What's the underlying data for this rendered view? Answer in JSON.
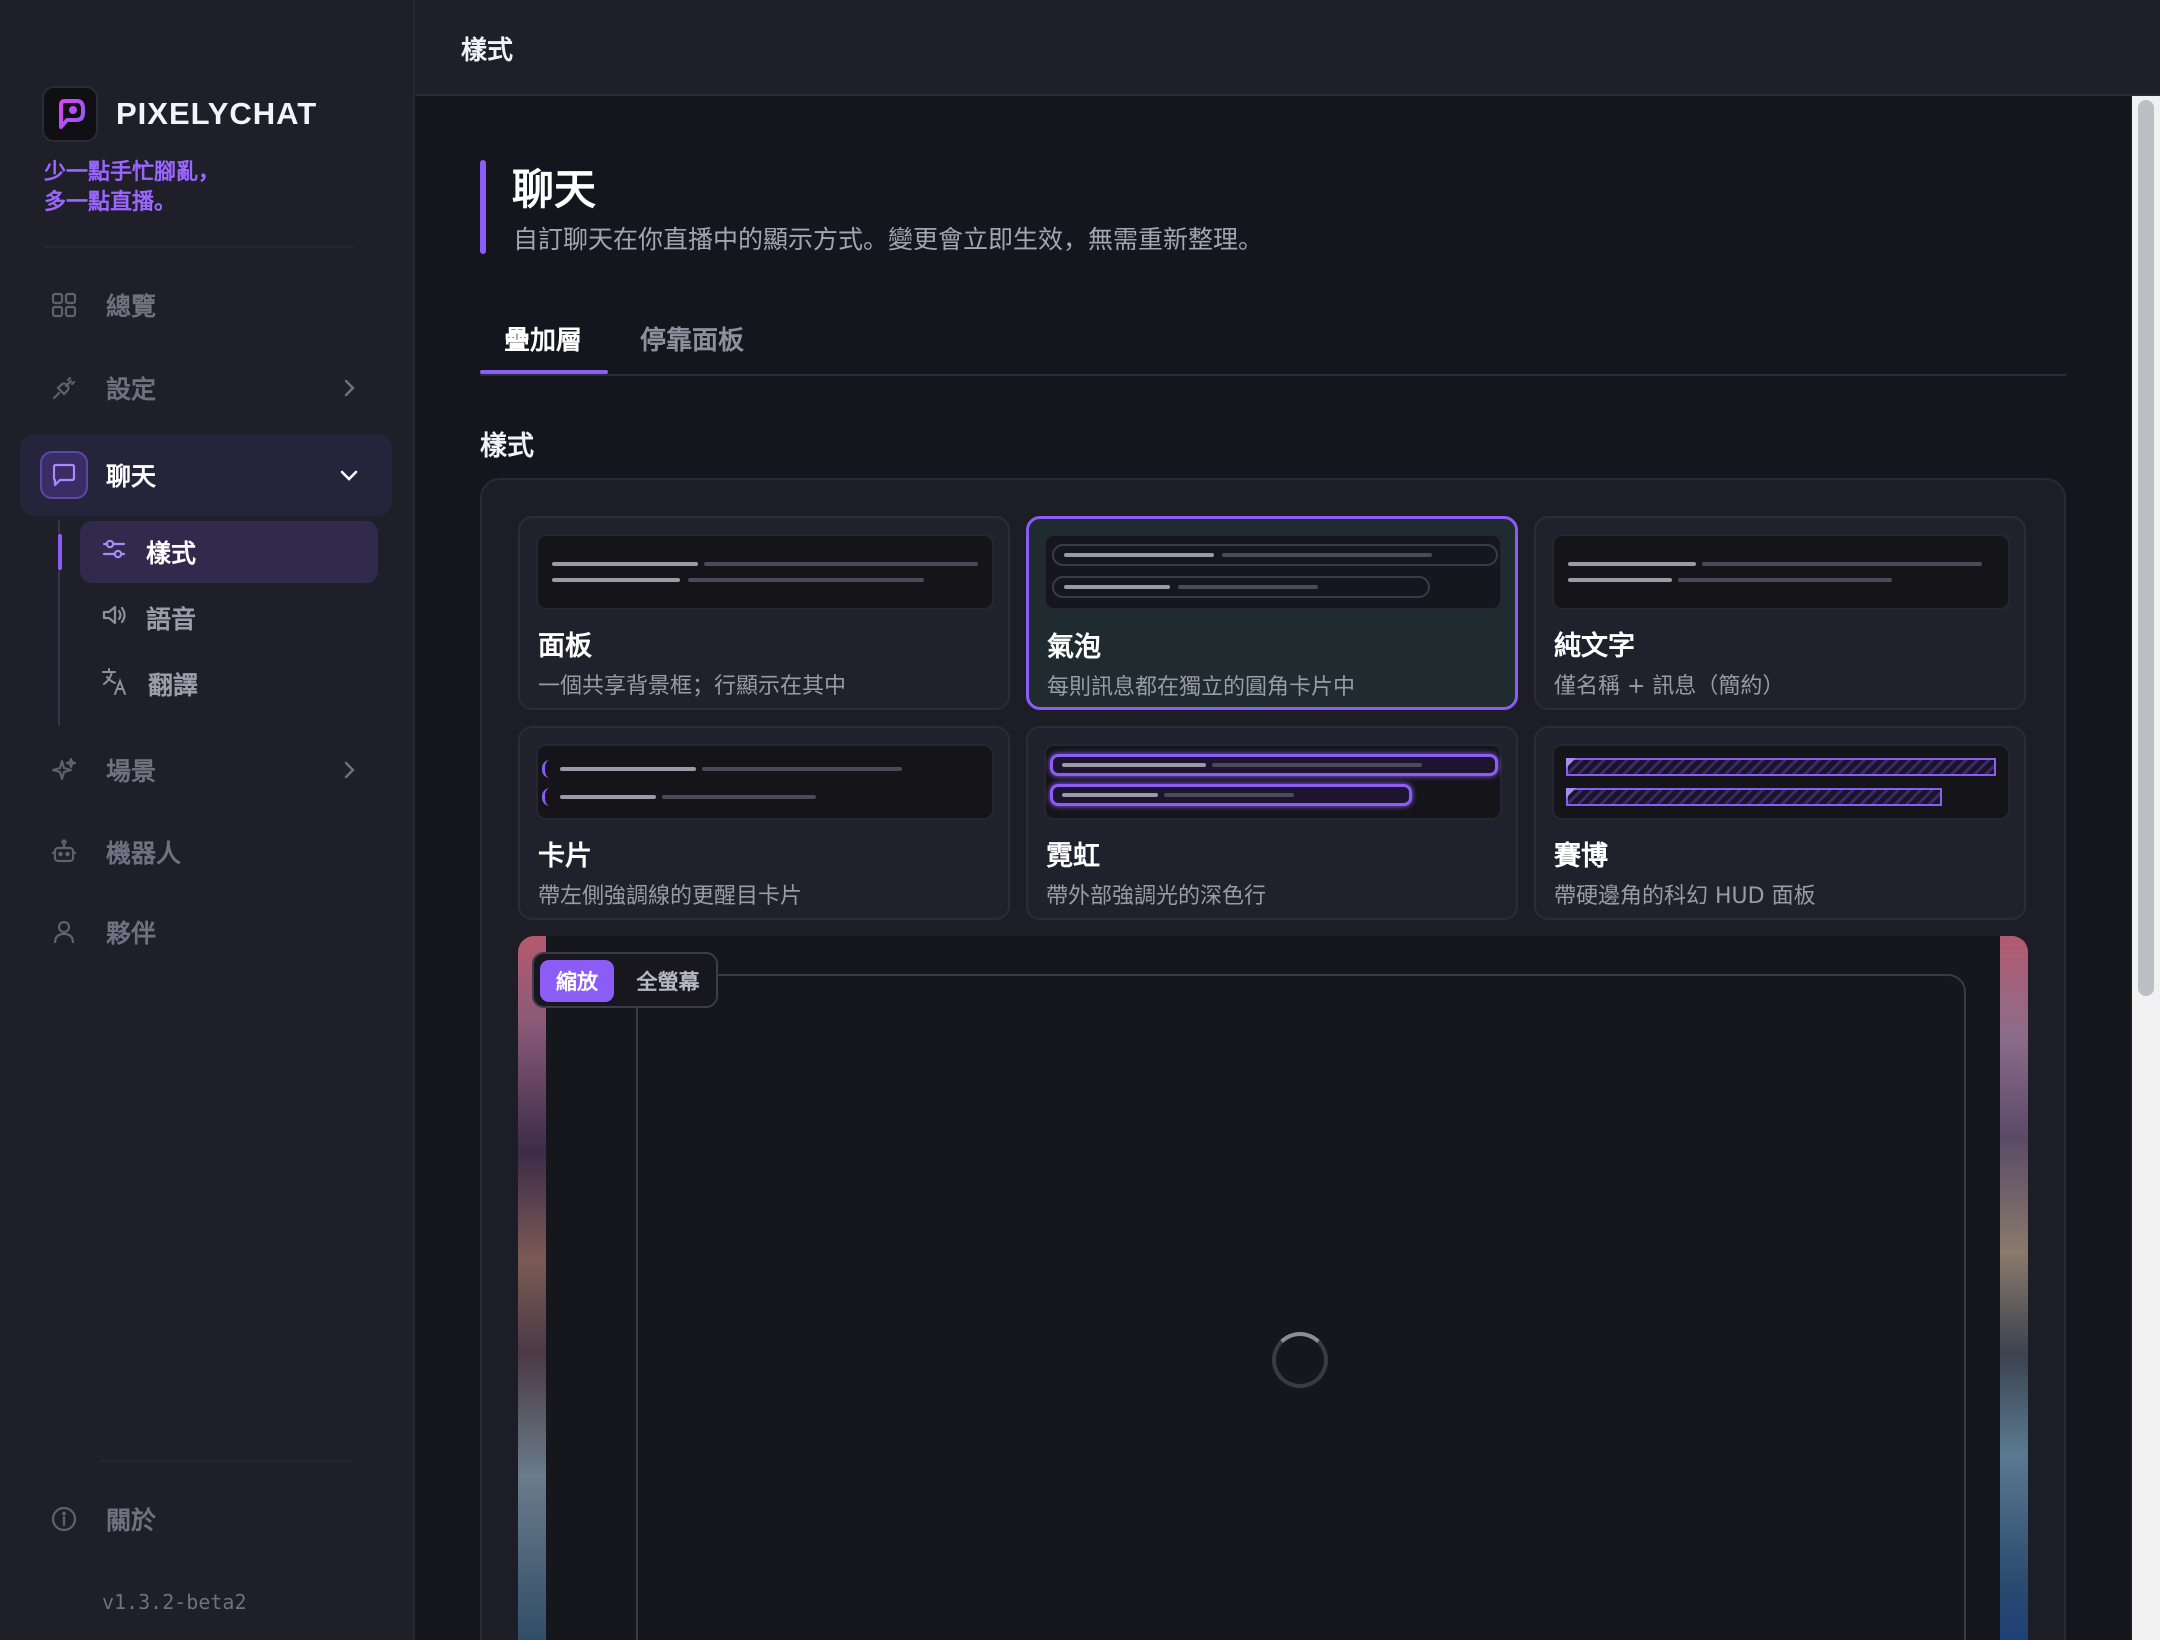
{
  "app": {
    "name": "PIXELYCHAT",
    "tagline": "少一點手忙腳亂，\n多一點直播。",
    "version": "v1.3.2-beta2",
    "accent_color": "#8b5cf6"
  },
  "sidebar": {
    "items": [
      {
        "label": "總覽",
        "icon": "grid-icon"
      },
      {
        "label": "設定",
        "icon": "plug-icon"
      },
      {
        "label": "聊天",
        "icon": "chat-bubble-icon"
      },
      {
        "label": "場景",
        "icon": "sparkle-icon"
      },
      {
        "label": "機器人",
        "icon": "robot-icon"
      },
      {
        "label": "夥伴",
        "icon": "user-icon"
      },
      {
        "label": "關於",
        "icon": "info-icon"
      }
    ],
    "chat_subitems": [
      {
        "label": "樣式",
        "icon": "sliders-icon",
        "active": true
      },
      {
        "label": "語音",
        "icon": "speaker-icon"
      },
      {
        "label": "翻譯",
        "icon": "translate-icon"
      }
    ]
  },
  "header": {
    "title": "樣式"
  },
  "page": {
    "title": "聊天",
    "subtitle": "自訂聊天在你直播中的顯示方式。變更會立即生效，無需重新整理。",
    "tabs": [
      {
        "label": "疊加層",
        "active": true
      },
      {
        "label": "停靠面板",
        "active": false
      }
    ],
    "section_title": "樣式",
    "styles": [
      {
        "name": "面板",
        "desc": "一個共享背景框；行顯示在其中"
      },
      {
        "name": "氣泡",
        "desc": "每則訊息都在獨立的圓角卡片中",
        "selected": true
      },
      {
        "name": "純文字",
        "desc": "僅名稱 + 訊息（簡約）"
      },
      {
        "name": "卡片",
        "desc": "帶左側強調線的更醒目卡片"
      },
      {
        "name": "霓虹",
        "desc": "帶外部強調光的深色行"
      },
      {
        "name": "賽博",
        "desc": "帶硬邊角的科幻 HUD 面板"
      }
    ],
    "preview": {
      "zoom_label": "縮放",
      "fullscreen_label": "全螢幕",
      "zoom_active": true
    }
  }
}
